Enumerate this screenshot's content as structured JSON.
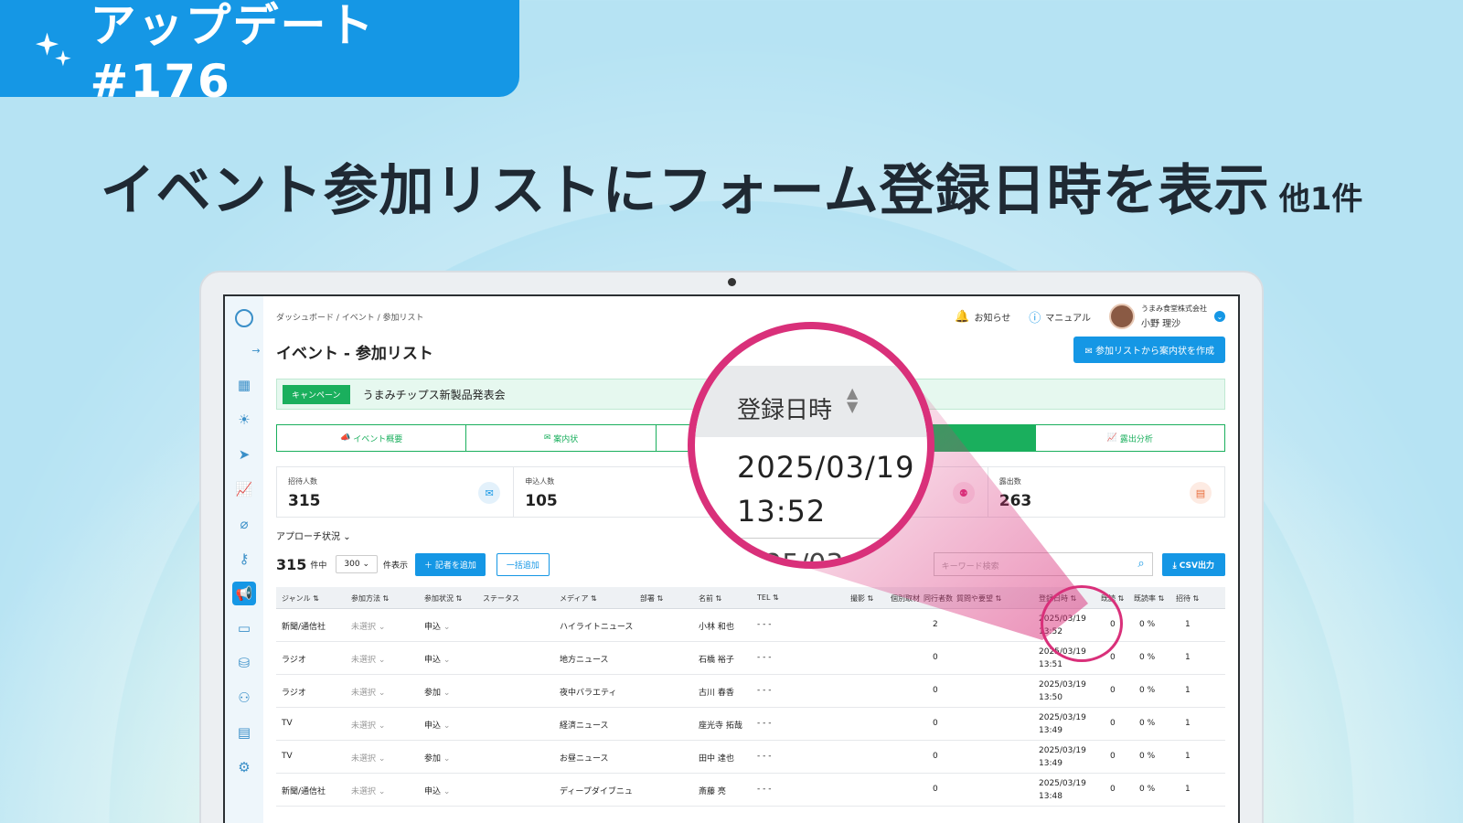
{
  "banner": {
    "text": "アップデート #176"
  },
  "headline": {
    "main": "イベント参加リストにフォーム登録日時を表示",
    "sub": "他1件"
  },
  "app": {
    "breadcrumb": "ダッシュボード / イベント / 参加リスト",
    "notifications": "お知らせ",
    "manual": "マニュアル",
    "user": {
      "company": "うまみ食堂株式会社",
      "name": "小野 理沙"
    },
    "page_title": "イベント - 参加リスト",
    "create_button": "参加リストから案内状を作成",
    "campaign": {
      "tag": "キャンペーン",
      "name": "うまみチップス新製品発表会"
    },
    "tabs": [
      {
        "label": "イベント概要",
        "icon": "megaphone-icon"
      },
      {
        "label": "案内状",
        "icon": "envelope-icon"
      },
      {
        "label": "",
        "icon": ""
      },
      {
        "label": "",
        "icon": ""
      },
      {
        "label": "露出分析",
        "icon": "chart-icon"
      }
    ],
    "stats": [
      {
        "label": "招待人数",
        "value": "315"
      },
      {
        "label": "申込人数",
        "value": "105"
      },
      {
        "label": "",
        "value": ""
      },
      {
        "label": "露出数",
        "value": "263"
      }
    ],
    "approach": "アプローチ状況",
    "count": "315",
    "count_unit": "件中",
    "page_size": "300",
    "page_size_suffix": "件表示",
    "add_reporter": "記者を追加",
    "bulk_add": "一括追加",
    "search_placeholder": "キーワード検索",
    "csv_button": "CSV出力",
    "columns": [
      "ジャンル",
      "参加方法",
      "参加状況",
      "ステータス",
      "メディア",
      "部署",
      "名前",
      "TEL",
      "撮影",
      "個別取材",
      "同行者数",
      "質問や要望",
      "登録日時",
      "既読",
      "既読率",
      "招待"
    ],
    "rows": [
      {
        "genre": "新聞/通信社",
        "method": "未選択",
        "status": "申込",
        "media": "ハイライトニュース",
        "name": "小林 和也",
        "tel": "- - -",
        "companions": "2",
        "date": "2025/03/19",
        "time": "13:52",
        "read": "0",
        "rate": "0 %",
        "invite": "1"
      },
      {
        "genre": "ラジオ",
        "method": "未選択",
        "status": "申込",
        "media": "地方ニュース",
        "name": "石橋 裕子",
        "tel": "- - -",
        "companions": "0",
        "date": "2025/03/19",
        "time": "13:51",
        "read": "0",
        "rate": "0 %",
        "invite": "1"
      },
      {
        "genre": "ラジオ",
        "method": "未選択",
        "status": "参加",
        "media": "夜中バラエティ",
        "name": "古川 春香",
        "tel": "- - -",
        "companions": "0",
        "date": "2025/03/19",
        "time": "13:50",
        "read": "0",
        "rate": "0 %",
        "invite": "1"
      },
      {
        "genre": "TV",
        "method": "未選択",
        "status": "申込",
        "media": "経済ニュース",
        "name": "座光寺 拓哉",
        "tel": "- - -",
        "companions": "0",
        "date": "2025/03/19",
        "time": "13:49",
        "read": "0",
        "rate": "0 %",
        "invite": "1"
      },
      {
        "genre": "TV",
        "method": "未選択",
        "status": "参加",
        "media": "お昼ニュース",
        "name": "田中 達也",
        "tel": "- - -",
        "companions": "0",
        "date": "2025/03/19",
        "time": "13:49",
        "read": "0",
        "rate": "0 %",
        "invite": "1"
      },
      {
        "genre": "新聞/通信社",
        "method": "未選択",
        "status": "申込",
        "media": "ディープダイブニュ",
        "name": "斎藤 亮",
        "tel": "- - -",
        "companions": "0",
        "date": "2025/03/19",
        "time": "13:48",
        "read": "0",
        "rate": "0 %",
        "invite": "1"
      }
    ]
  },
  "zoom": {
    "header": "登録日時",
    "date": "2025/03/19",
    "time": "13:52",
    "next_partial": "25/03"
  },
  "colors": {
    "accent": "#1597e5",
    "green": "#1aaf5d",
    "highlight": "#d9307a"
  }
}
